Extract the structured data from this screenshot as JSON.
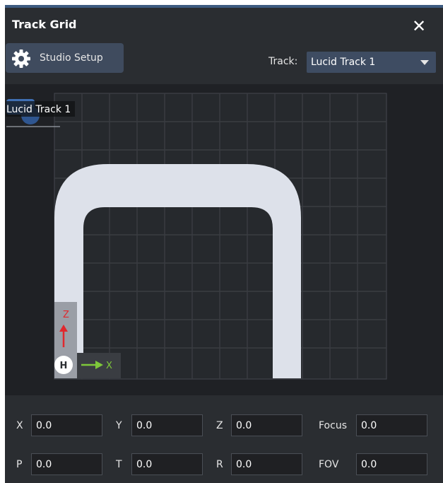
{
  "window": {
    "title": "Track Grid"
  },
  "toolbar": {
    "studio_setup_label": "Studio Setup",
    "track_label": "Track:",
    "track_selected": "Lucid Track 1"
  },
  "canvas": {
    "track_name_tag": "Lucid Track 1",
    "origin_marker": "H",
    "axis_x_label": "X",
    "axis_z_label": "Z"
  },
  "fields": {
    "x": {
      "label": "X",
      "value": "0.0"
    },
    "y": {
      "label": "Y",
      "value": "0.0"
    },
    "z": {
      "label": "Z",
      "value": "0.0"
    },
    "focus": {
      "label": "Focus",
      "value": "0.0"
    },
    "p": {
      "label": "P",
      "value": "0.0"
    },
    "t": {
      "label": "T",
      "value": "0.0"
    },
    "r": {
      "label": "R",
      "value": "0.0"
    },
    "fov": {
      "label": "FOV",
      "value": "0.0"
    }
  },
  "colors": {
    "window_bg": "#2a2d31",
    "canvas_bg": "#1f2125",
    "grid_line": "#3a3d42",
    "track_fill": "#dde1ea",
    "accent_blue": "#3f6fb3",
    "axis_x": "#7ec83a",
    "axis_z": "#e0282d",
    "dropdown_bg": "#3e4c62"
  }
}
